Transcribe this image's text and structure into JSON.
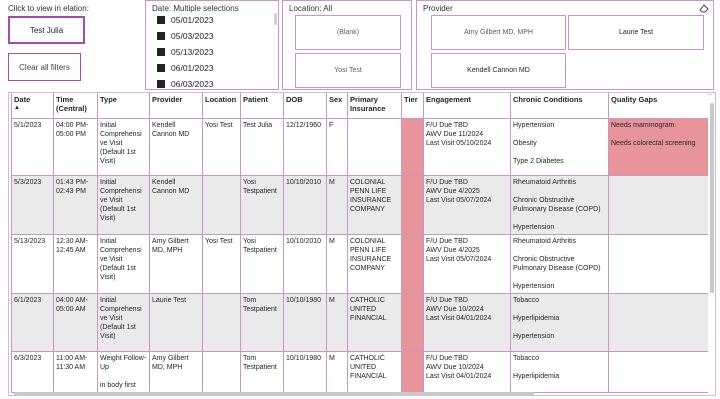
{
  "view_panel": {
    "label": "Click to view in elation:",
    "patient_button": "Test Julia",
    "clear_button": "Clear all filters"
  },
  "date_panel": {
    "title": "Date: Multiple selections",
    "items": [
      "05/01/2023",
      "05/03/2023",
      "05/13/2023",
      "06/01/2023",
      "06/03/2023"
    ]
  },
  "location_panel": {
    "title": "Location: All",
    "tiles": [
      "(Blank)",
      "Yosi Test"
    ]
  },
  "provider_panel": {
    "title": "Provider",
    "tiles": [
      "Amy Gilbert MD, MPH",
      "Laurie Test",
      "Kendell Cannon MD"
    ],
    "eraser_icon": "eraser-icon"
  },
  "table": {
    "headers": [
      "Date",
      "Time (Central)",
      "Type",
      "Provider",
      "Location",
      "Patient",
      "DOB",
      "Sex",
      "Primary Insurance",
      "Tier",
      "Engagement",
      "Chronic Conditions",
      "Quality Gaps"
    ],
    "sort_indicator": "▲",
    "rows": [
      {
        "date": "5/1/2023",
        "time": "04:00 PM-05:00 PM",
        "type": "Initial Comprehensi ve Visit (Default 1st Visit)",
        "provider": "Kendell Cannon MD",
        "location": "Yosi Test",
        "patient": "Test Julia",
        "dob": "12/12/1960",
        "sex": "F",
        "insurance": "",
        "engagement": "F/U Due TBD\nAWV Due 11/2024\nLast Visit 05/10/2024",
        "conditions": "Hypertension\n\nObesity\n\nType 2 Diabetes",
        "gaps": "Needs mammogram\n\nNeeds colorectal screening"
      },
      {
        "date": "5/3/2023",
        "time": "01:43 PM-02:43 PM",
        "type": "Initial Comprehensi ve Visit (Default 1st Visit)",
        "provider": "Kendell Cannon MD",
        "location": "",
        "patient": "Yosi Testpatient",
        "dob": "10/10/2010",
        "sex": "M",
        "insurance": "COLONIAL PENN LIFE INSURANCE COMPANY",
        "engagement": "F/U Due TBD\nAWV Due 4/2025\nLast Visit 05/07/2024",
        "conditions": "Rheumatoid Arthritis\n\nChronic Obstructive Pulmonary Disease (COPD)\n\nHypertension",
        "gaps": ""
      },
      {
        "date": "5/13/2023",
        "time": "12:30 AM-12:45 AM",
        "type": "Initial Comprehensi ve Visit (Default 1st Visit)",
        "provider": "Amy Gilbert MD, MPH",
        "location": "Yosi Test",
        "patient": "Yosi Testpatient",
        "dob": "10/10/2010",
        "sex": "M",
        "insurance": "COLONIAL PENN LIFE INSURANCE COMPANY",
        "engagement": "F/U Due TBD\nAWV Due 4/2025\nLast Visit 05/07/2024",
        "conditions": "Rheumatoid Arthritis\n\nChronic Obstructive Pulmonary Disease (COPD)\n\nHypertension",
        "gaps": ""
      },
      {
        "date": "6/1/2023",
        "time": "04:00 AM-05:00 AM",
        "type": "Initial Comprehensi ve Visit (Default 1st Visit)",
        "provider": "Laurie Test",
        "location": "",
        "patient": "Tom Testpatient",
        "dob": "10/10/1980",
        "sex": "M",
        "insurance": "CATHOLIC UNITED FINANCIAL",
        "engagement": "F/U Due TBD\nAWV Due 10/2024\nLast Visit 04/01/2024",
        "conditions": "Tobacco\n\nHyperlipidemia\n\nHypertension",
        "gaps": ""
      },
      {
        "date": "6/3/2023",
        "time": "11:00 AM-11:30 AM",
        "type": "Weight Follow-Up\n\nin body first",
        "provider": "Amy Gilbert MD, MPH",
        "location": "",
        "patient": "Tom Testpatient",
        "dob": "10/10/1980",
        "sex": "M",
        "insurance": "CATHOLIC UNITED FINANCIAL",
        "engagement": "F/U Due TBD\nAWV Due 10/2024\nLast Visit 04/01/2024",
        "conditions": "Tobacco\n\nHyperlipidemia",
        "gaps": ""
      }
    ]
  },
  "visual_icons": [
    "pin-icon",
    "filter-icon",
    "focus-mode-icon",
    "more-options-icon"
  ],
  "colors": {
    "accent": "#a64ca6",
    "border": "#c896c8",
    "tier_fill": "#e8949b",
    "gap_fill": "#e8949b",
    "alt_row": "#eaeaea"
  }
}
